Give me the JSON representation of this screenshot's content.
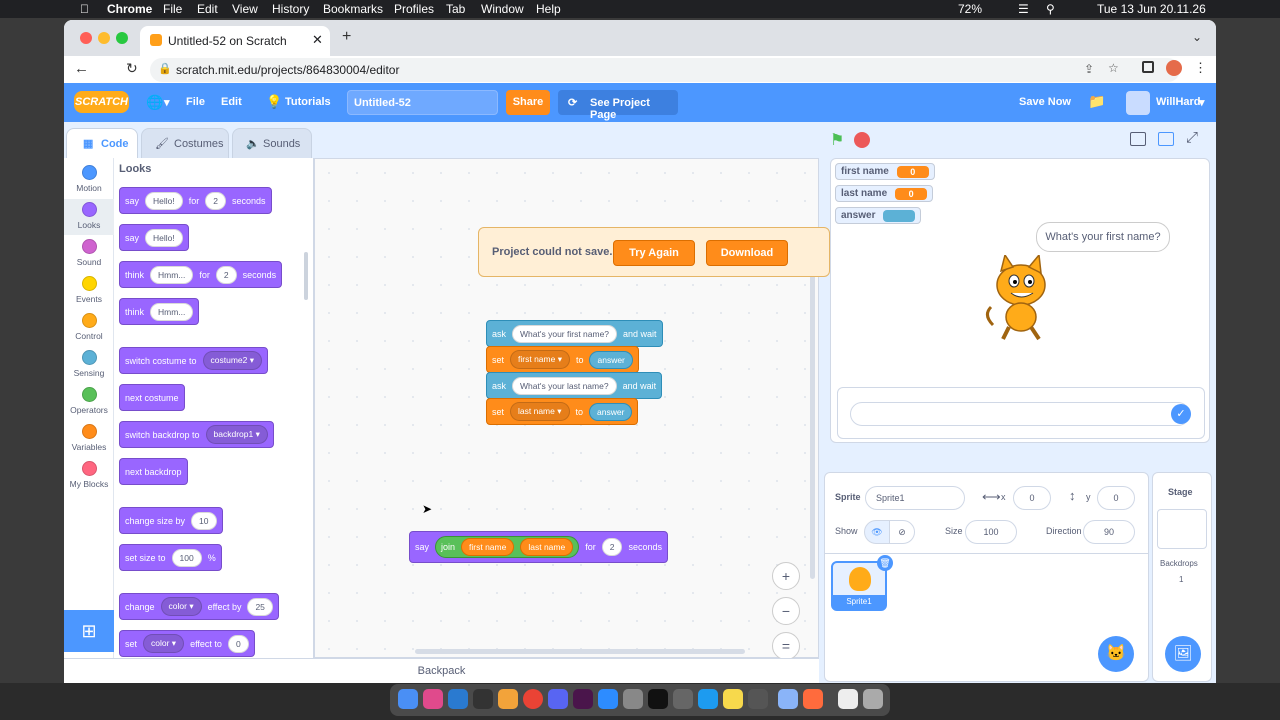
{
  "menubar": {
    "apple": "",
    "app": "Chrome",
    "items": [
      "File",
      "Edit",
      "View",
      "History",
      "Bookmarks",
      "Profiles",
      "Tab",
      "Window",
      "Help"
    ],
    "battery": "72%",
    "datetime": "Tue 13 Jun  20.11.26"
  },
  "browser": {
    "tab_title": "Untitled-52 on Scratch",
    "url": "scratch.mit.edu/projects/864830004/editor"
  },
  "scratch_menu": {
    "logo": "SCRATCH",
    "file": "File",
    "edit": "Edit",
    "tutorials": "Tutorials",
    "project_title": "Untitled-52",
    "share": "Share",
    "see_project": "See Project Page",
    "save_now": "Save Now",
    "user": "WillHard"
  },
  "editor_tabs": {
    "code": "Code",
    "costumes": "Costumes",
    "sounds": "Sounds"
  },
  "categories": [
    {
      "label": "Motion",
      "color": "#4c97ff"
    },
    {
      "label": "Looks",
      "color": "#9966ff"
    },
    {
      "label": "Sound",
      "color": "#cf63cf"
    },
    {
      "label": "Events",
      "color": "#ffd500"
    },
    {
      "label": "Control",
      "color": "#ffab19"
    },
    {
      "label": "Sensing",
      "color": "#5cb1d6"
    },
    {
      "label": "Operators",
      "color": "#59c059"
    },
    {
      "label": "Variables",
      "color": "#ff8c1a"
    },
    {
      "label": "My Blocks",
      "color": "#ff6680"
    }
  ],
  "palette": {
    "heading": "Looks",
    "say_for": {
      "say": "say",
      "msg": "Hello!",
      "for": "for",
      "secs": "2",
      "seconds": "seconds"
    },
    "say": {
      "say": "say",
      "msg": "Hello!"
    },
    "think_for": {
      "think": "think",
      "msg": "Hmm...",
      "for": "for",
      "secs": "2",
      "seconds": "seconds"
    },
    "think": {
      "think": "think",
      "msg": "Hmm..."
    },
    "switch_costume": {
      "text": "switch costume to",
      "value": "costume2 ▾"
    },
    "next_costume": "next costume",
    "switch_backdrop": {
      "text": "switch backdrop to",
      "value": "backdrop1 ▾"
    },
    "next_backdrop": "next backdrop",
    "change_size": {
      "text": "change size by",
      "value": "10"
    },
    "set_size": {
      "text": "set size to",
      "value": "100",
      "unit": "%"
    },
    "change_effect": {
      "change": "change",
      "effect": "color ▾",
      "by": "effect by",
      "value": "25"
    },
    "set_effect": {
      "set": "set",
      "effect": "color ▾",
      "to": "effect to",
      "value": "0"
    }
  },
  "script1": {
    "ask1": {
      "ask": "ask",
      "question": "What's your first name?",
      "wait": "and wait"
    },
    "set1": {
      "set": "set",
      "var": "first name ▾",
      "to": "to",
      "value": "answer"
    },
    "ask2": {
      "ask": "ask",
      "question": "What's your last name?",
      "wait": "and wait"
    },
    "set2": {
      "set": "set",
      "var": "last name ▾",
      "to": "to",
      "value": "answer"
    }
  },
  "script2": {
    "say": "say",
    "join": "join",
    "a": "first name",
    "b": "last name",
    "for": "for",
    "secs": "2",
    "seconds": "seconds"
  },
  "alert": {
    "message": "Project could not save.",
    "try_again": "Try Again",
    "download": "Download"
  },
  "stage": {
    "monitors": [
      {
        "name": "first name",
        "value": "0"
      },
      {
        "name": "last name",
        "value": "0"
      },
      {
        "name": "answer",
        "value": ""
      }
    ],
    "speech": "What's your first name?"
  },
  "sprite_info": {
    "sprite_label": "Sprite",
    "sprite_name": "Sprite1",
    "x_label": "x",
    "x": "0",
    "y_label": "y",
    "y": "0",
    "show_label": "Show",
    "size_label": "Size",
    "size": "100",
    "direction_label": "Direction",
    "direction": "90",
    "thumb_name": "Sprite1"
  },
  "stage_panel": {
    "title": "Stage",
    "backdrops_label": "Backdrops",
    "backdrops_count": "1"
  },
  "backpack": "Backpack"
}
